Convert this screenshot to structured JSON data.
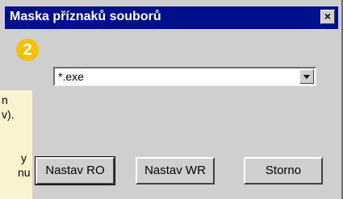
{
  "dialog": {
    "title": "Maska příznaků souborů",
    "close_glyph": "×",
    "badge_number": "2"
  },
  "combo": {
    "value": "*.exe"
  },
  "note": {
    "lines": [
      "n",
      "v).",
      "",
      "y",
      "nu"
    ]
  },
  "buttons": {
    "set_ro": "Nastav RO",
    "set_wr": "Nastav WR",
    "cancel": "Storno"
  }
}
